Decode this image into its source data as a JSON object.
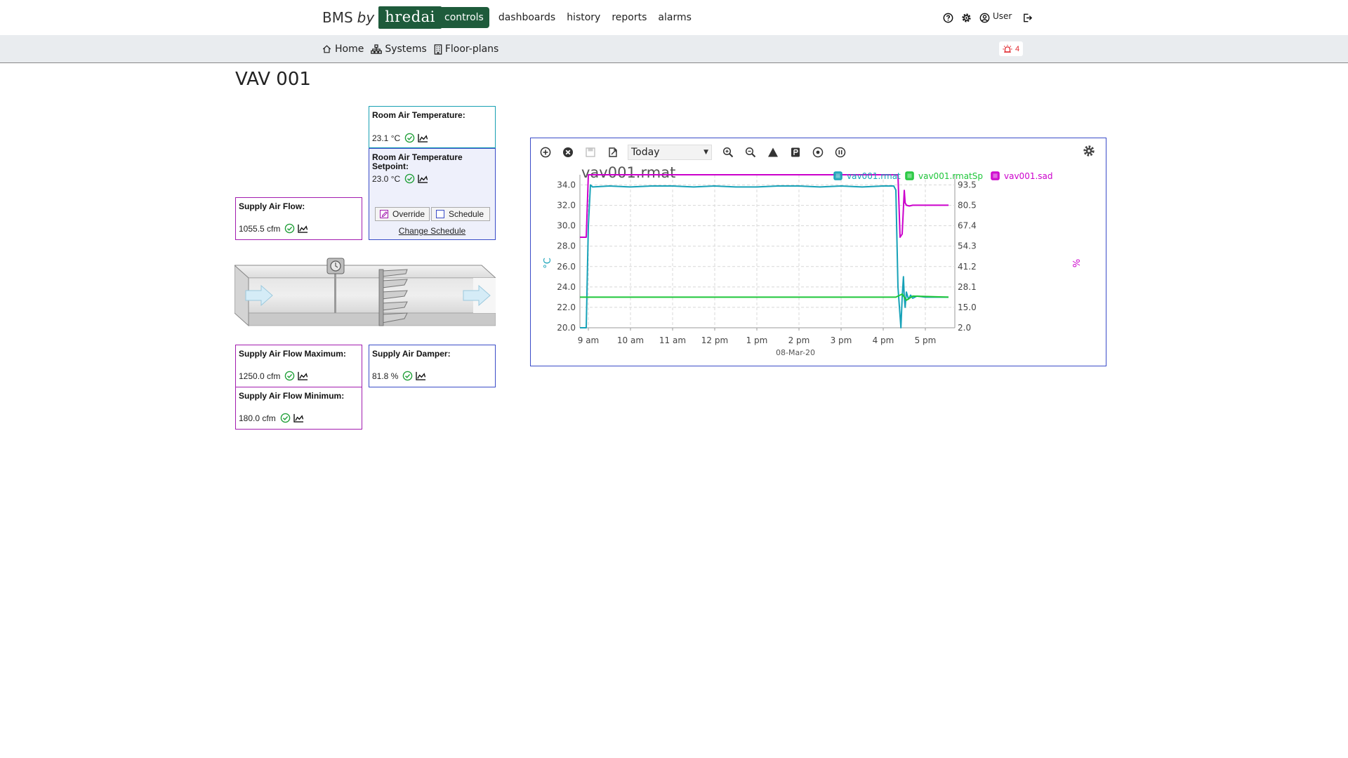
{
  "brand": {
    "prefix": "BMS",
    "by": "by",
    "logo": "hredai"
  },
  "nav": {
    "items": [
      {
        "label": "controls",
        "active": true
      },
      {
        "label": "dashboards",
        "active": false
      },
      {
        "label": "history",
        "active": false
      },
      {
        "label": "reports",
        "active": false
      },
      {
        "label": "alarms",
        "active": false
      }
    ],
    "right": {
      "help_icon": "question-circle-icon",
      "settings_icon": "gear-icon",
      "user_icon": "user-circle-icon",
      "user_label": "User",
      "logout_icon": "logout-icon"
    }
  },
  "subnav": {
    "items": [
      {
        "label": "Home",
        "icon": "home-icon"
      },
      {
        "label": "Systems",
        "icon": "sitemap-icon"
      },
      {
        "label": "Floor-plans",
        "icon": "building-icon"
      }
    ],
    "alarm_count": "4",
    "alarm_icon": "siren-icon"
  },
  "page": {
    "title": "VAV 001"
  },
  "points": {
    "room_air_temp": {
      "label": "Room Air Temperature:",
      "value": "23.1 °C"
    },
    "room_air_temp_sp": {
      "label": "Room Air Temperature Setpoint:",
      "value": "23.0 °C",
      "override_label": "Override",
      "schedule_label": "Schedule",
      "change_schedule": "Change Schedule",
      "override_checked": true,
      "schedule_checked": false
    },
    "supply_air_flow": {
      "label": "Supply Air Flow:",
      "value": "1055.5 cfm"
    },
    "supply_air_flow_max": {
      "label": "Supply Air Flow Maximum:",
      "value": "1250.0 cfm"
    },
    "supply_air_flow_min": {
      "label": "Supply Air Flow Minimum:",
      "value": "180.0 cfm"
    },
    "supply_air_damper": {
      "label": "Supply Air Damper:",
      "value": "81.8 %"
    }
  },
  "chart_toolbar": {
    "range": "Today",
    "icons": [
      "add-circle-icon",
      "remove-circle-icon",
      "save-icon",
      "export-icon",
      "zoom-in-icon",
      "zoom-out-icon",
      "warning-triangle-icon",
      "note-icon",
      "target-icon",
      "pause-icon"
    ],
    "settings_icon": "gear-icon"
  },
  "colors": {
    "rmat": "#17a2b8",
    "rmatSp": "#1fc63a",
    "sad": "#cc00cc",
    "brand": "#1e5b3b",
    "panel_border": "#3a4cc8"
  },
  "chart_data": {
    "type": "line",
    "title": "vav001.rmat",
    "xlabel": "08-Mar-20",
    "ylabel_left": "°C",
    "ylabel_right": "%",
    "x_ticks": [
      "9 am",
      "10 am",
      "11 am",
      "12 pm",
      "1 pm",
      "2 pm",
      "3 pm",
      "4 pm",
      "5 pm"
    ],
    "x_range_hours": [
      8.8,
      17.7
    ],
    "y_left_ticks": [
      "20.0",
      "22.0",
      "24.0",
      "26.0",
      "28.0",
      "30.0",
      "32.0",
      "34.0"
    ],
    "y_left_range": [
      20,
      35
    ],
    "y_right_ticks": [
      "2.0",
      "15.0",
      "28.1",
      "41.2",
      "54.3",
      "67.4",
      "80.5",
      "93.5"
    ],
    "y_right_range": [
      2,
      100
    ],
    "grid": true,
    "legend_position": "top-right",
    "series": [
      {
        "name": "vav001.rmat",
        "axis": "left",
        "x": [
          8.8,
          8.95,
          9.0,
          9.05,
          9.1,
          9.5,
          10.0,
          10.5,
          11.0,
          11.5,
          12.0,
          12.5,
          13.0,
          13.5,
          14.0,
          14.5,
          15.0,
          15.5,
          16.0,
          16.25,
          16.3,
          16.35,
          16.42,
          16.45,
          16.48,
          16.5,
          16.52,
          16.55,
          16.6,
          16.65,
          16.7,
          16.8,
          17.0,
          17.3,
          17.55
        ],
        "y": [
          20.0,
          20.0,
          30.0,
          34.0,
          33.8,
          33.9,
          33.8,
          33.9,
          33.9,
          33.8,
          33.9,
          33.8,
          33.8,
          33.9,
          33.9,
          33.8,
          33.9,
          33.8,
          33.9,
          33.9,
          33.5,
          24.0,
          20.0,
          23.0,
          25.0,
          23.0,
          22.0,
          23.5,
          22.8,
          23.2,
          22.9,
          23.1,
          23.0,
          23.0,
          23.0
        ]
      },
      {
        "name": "vav001.rmatSp",
        "axis": "left",
        "x": [
          8.8,
          16.3,
          16.45,
          16.55,
          16.7,
          17.55
        ],
        "y": [
          23.0,
          23.0,
          23.3,
          22.7,
          23.1,
          23.0
        ]
      },
      {
        "name": "vav001.sad",
        "axis": "right",
        "x": [
          8.8,
          8.95,
          9.0,
          16.35,
          16.4,
          16.45,
          16.5,
          16.52,
          16.55,
          16.62,
          16.7,
          17.0,
          17.55
        ],
        "y": [
          60.0,
          60.0,
          100.0,
          100.0,
          60.0,
          62.0,
          90.0,
          82.0,
          80.5,
          80.0,
          80.5,
          80.5,
          80.5
        ]
      }
    ]
  }
}
